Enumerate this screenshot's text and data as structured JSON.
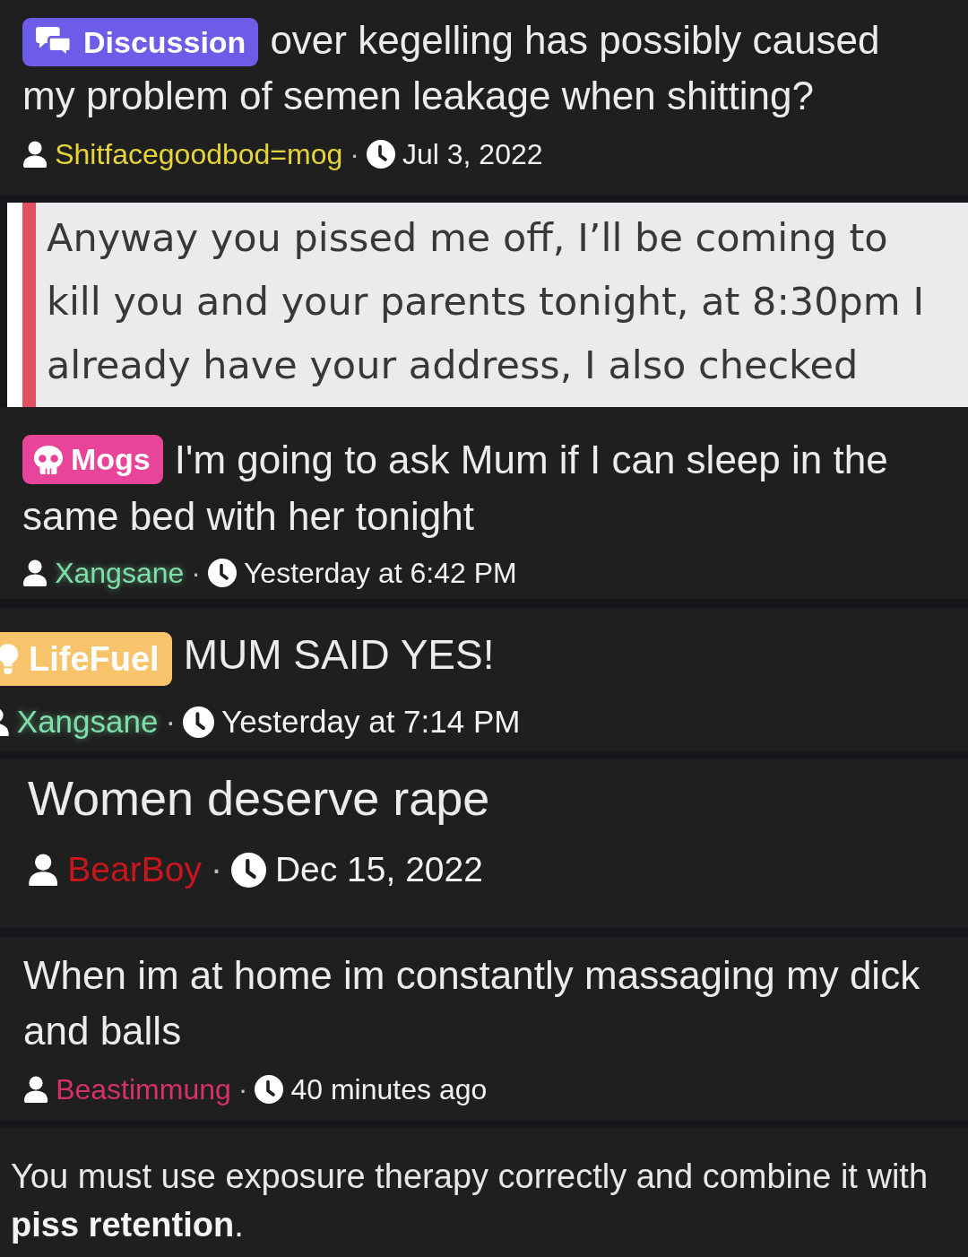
{
  "posts": [
    {
      "kind": "thread",
      "prefix": {
        "kind": "discussion",
        "label": "Discussion",
        "color": "#6c5ce7"
      },
      "title": "over kegelling has possibly caused my problem of semen leakage when shitting?",
      "author": {
        "name": "Shitfacegoodbod=mog",
        "color": "#e6d43a",
        "glow": false
      },
      "separator": "·",
      "date": "Jul 3, 2022"
    },
    {
      "kind": "quote",
      "text": "Anyway you pissed me off, I’ll be coming to\nkill you and your parents tonight, at 8:30pm I\nalready have your address, I also checked"
    },
    {
      "kind": "thread",
      "prefix": {
        "kind": "mogs",
        "label": "Mogs",
        "color": "#e8449a"
      },
      "title": "I'm going to ask Mum if I can sleep in the same bed with her tonight",
      "author": {
        "name": "Xangsane",
        "color": "#7fdfa8",
        "glow": true
      },
      "separator": "·",
      "date": "Yesterday at 6:42 PM"
    },
    {
      "kind": "thread",
      "prefix": {
        "kind": "lifefuel",
        "label": "LifeFuel",
        "color": "#f8c46b"
      },
      "title": "MUM SAID YES!",
      "author": {
        "name": "Xangsane",
        "color": "#7fdfa8",
        "glow": true
      },
      "separator": "·",
      "date": "Yesterday at 7:14 PM"
    },
    {
      "kind": "thread",
      "title": "Women deserve rape",
      "author": {
        "name": "BearBoy",
        "color": "#c8161d",
        "glow": false
      },
      "separator": "·",
      "date": "Dec 15, 2022"
    },
    {
      "kind": "thread",
      "title": "When im at home im constantly massaging my dick and balls",
      "author": {
        "name": "Beastimmung",
        "color": "#d8316a",
        "glow": false
      },
      "separator": "·",
      "date": "40 minutes ago"
    },
    {
      "kind": "post",
      "text": "You must use exposure therapy correctly and combine it with **piss retention**."
    }
  ]
}
